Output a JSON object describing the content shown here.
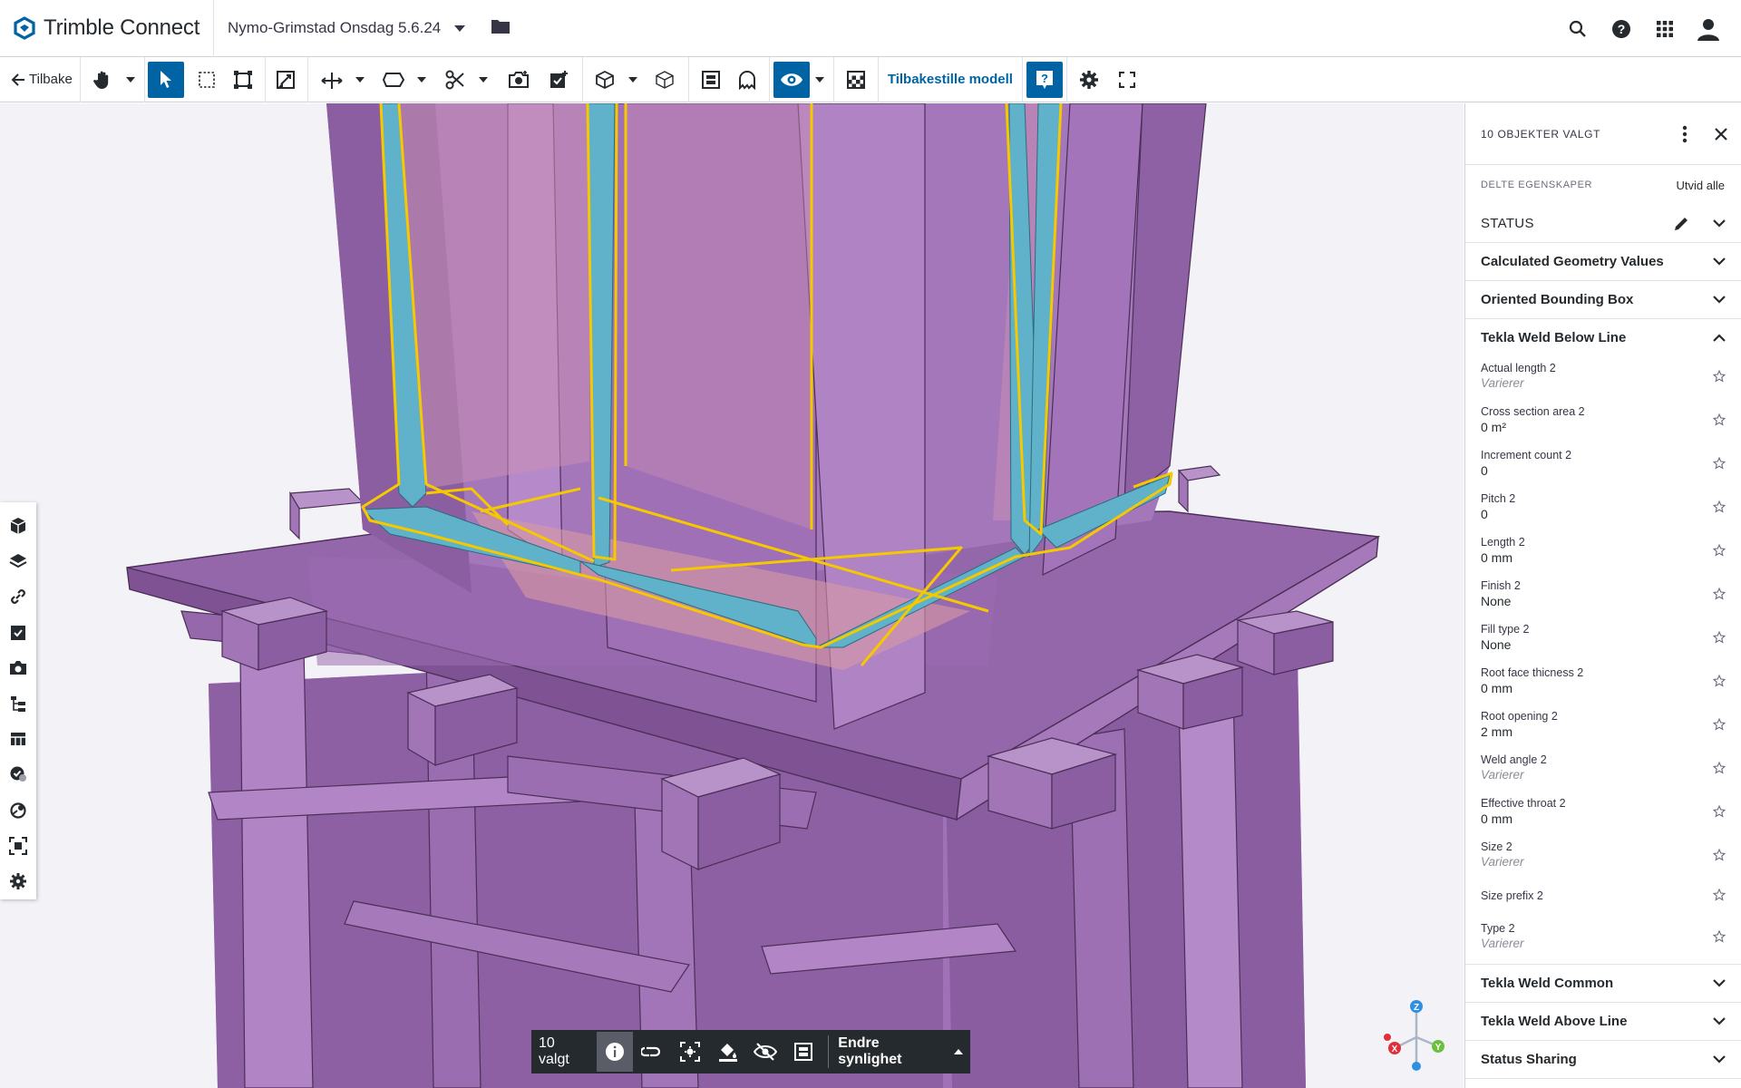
{
  "app": {
    "brand": "Trimble Connect",
    "project": "Nymo-Grimstad Onsdag 5.6.24"
  },
  "toolbar": {
    "back_label": "Tilbake",
    "reset_model_label": "Tilbakestille modell"
  },
  "selection_bar": {
    "count_label": "10 valgt",
    "visibility_label": "Endre synlighet"
  },
  "panel": {
    "title": "10 OBJEKTER VALGT",
    "shared_properties_label": "DELTE EGENSKAPER",
    "expand_all_label": "Utvid alle",
    "sections": [
      {
        "title": "STATUS"
      },
      {
        "title": "Calculated Geometry Values"
      },
      {
        "title": "Oriented Bounding Box"
      },
      {
        "title": "Tekla Weld Below Line"
      },
      {
        "title": "Tekla Weld Common"
      },
      {
        "title": "Tekla Weld Above Line"
      },
      {
        "title": "Status Sharing"
      }
    ],
    "properties": [
      {
        "name": "Actual length 2",
        "value": "Varierer"
      },
      {
        "name": "Cross section area 2",
        "value": "0 m²"
      },
      {
        "name": "Increment count 2",
        "value": "0"
      },
      {
        "name": "Pitch 2",
        "value": "0"
      },
      {
        "name": "Length 2",
        "value": "0 mm"
      },
      {
        "name": "Finish 2",
        "value": "None"
      },
      {
        "name": "Fill type 2",
        "value": "None"
      },
      {
        "name": "Root face thicness 2",
        "value": "0 mm"
      },
      {
        "name": "Root opening 2",
        "value": "2 mm"
      },
      {
        "name": "Weld angle 2",
        "value": "Varierer"
      },
      {
        "name": "Effective throat 2",
        "value": "0 mm"
      },
      {
        "name": "Size 2",
        "value": "Varierer"
      },
      {
        "name": "Size prefix 2",
        "value": ""
      },
      {
        "name": "Type 2",
        "value": "Varierer"
      }
    ]
  },
  "axis": {
    "z": "Z",
    "x": "X",
    "y": "Y"
  },
  "colors": {
    "accent": "#0063a3",
    "steel": "#9b6ab0",
    "weld": "#5fb2c9",
    "selection_outline": "#f5c800"
  }
}
